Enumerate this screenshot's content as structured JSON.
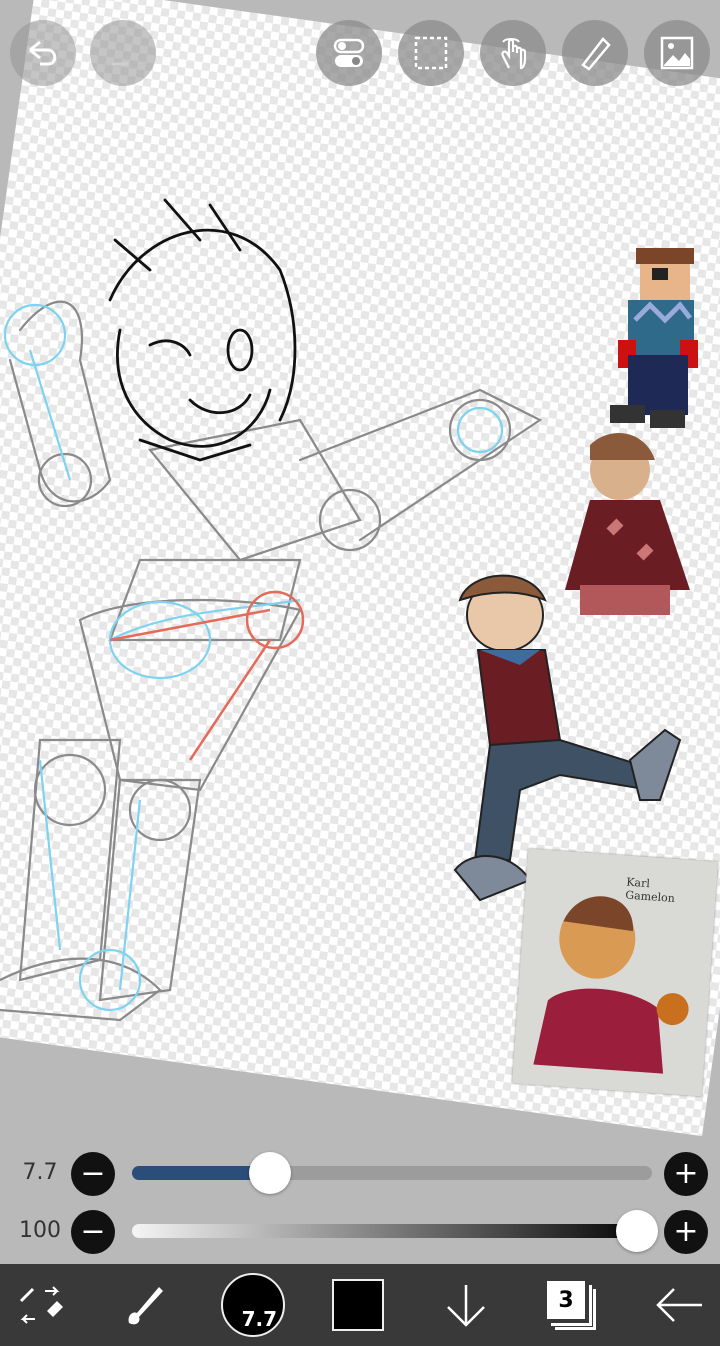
{
  "toolbar": {
    "undo_icon": "undo-icon",
    "redo_icon": "redo-icon",
    "buttons": [
      "toggle-icon",
      "selection-icon",
      "gesture-icon",
      "ruler-icon",
      "image-icon"
    ]
  },
  "brush_size": {
    "label": "7.7",
    "level": 0.265
  },
  "brush_opacity": {
    "label": "100",
    "level": 1.0
  },
  "bottom": {
    "brush_indicator": "7.7",
    "layer_count": "3",
    "color": "#000000"
  },
  "reference_photo": {
    "caption_line1": "Karl",
    "caption_line2": "Gamelon"
  },
  "colors": {
    "slider_fill": "#2b4d7a",
    "bottom_bar": "#393939"
  }
}
